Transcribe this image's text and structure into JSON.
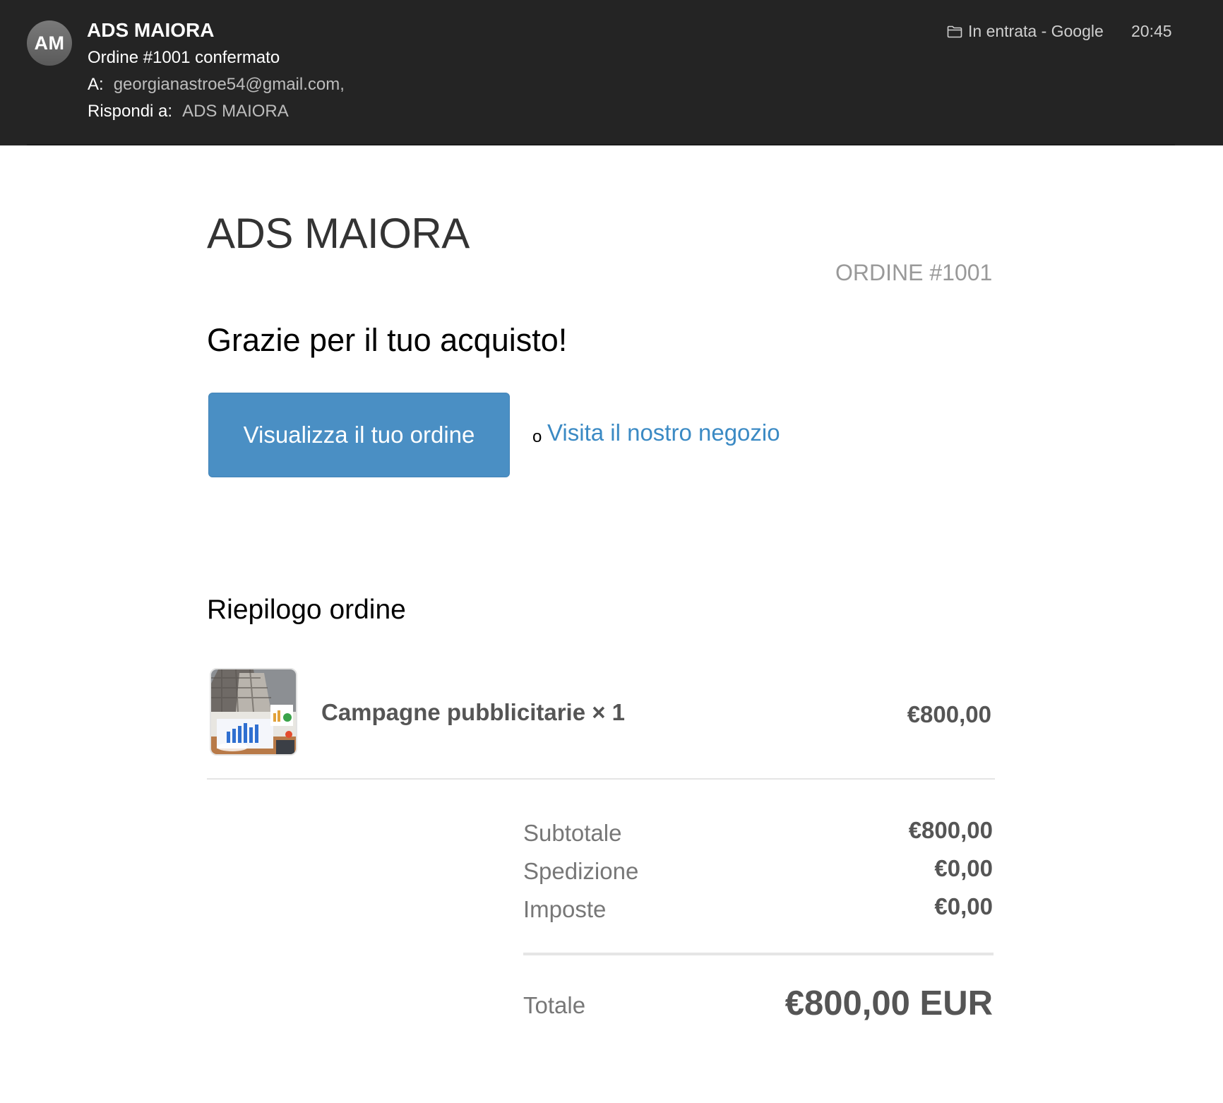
{
  "email": {
    "avatar_initials": "AM",
    "sender_name": "ADS MAIORA",
    "subject": "Ordine #1001 confermato",
    "to_label": "A:",
    "to_value": "georgianastroe54@gmail.com,",
    "reply_to_label": "Rispondi a:",
    "reply_to_value": "ADS MAIORA",
    "folder": "In entrata - Google",
    "folder_icon": "folder-icon",
    "time": "20:45"
  },
  "body": {
    "shop_name": "ADS MAIORA",
    "order_number": "ORDINE #1001",
    "thanks": "Grazie per il tuo acquisto!",
    "view_order_button": "Visualizza il tuo ordine",
    "or_text": "o",
    "visit_store_link": "Visita il nostro negozio",
    "link_color": "#3b8ac4",
    "button_color": "#4a8fc4"
  },
  "summary": {
    "title": "Riepilogo ordine",
    "items": [
      {
        "title": "Campagne pubblicitarie × 1",
        "price": "€800,00"
      }
    ],
    "subtotal_label": "Subtotale",
    "subtotal_value": "€800,00",
    "shipping_label": "Spedizione",
    "shipping_value": "€0,00",
    "taxes_label": "Imposte",
    "taxes_value": "€0,00",
    "total_label": "Totale",
    "total_value": "€800,00 EUR"
  }
}
